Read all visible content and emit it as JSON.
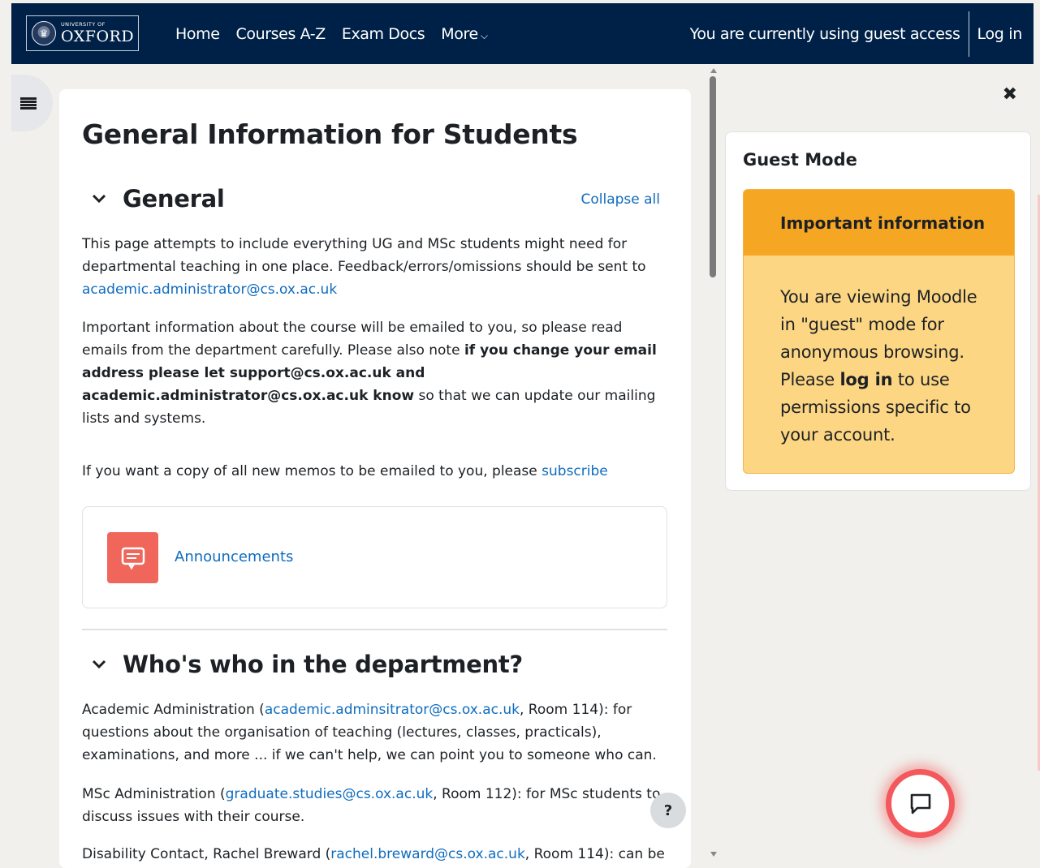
{
  "header": {
    "logo": {
      "line1": "UNIVERSITY OF",
      "line2": "OXFORD",
      "icon": "crest-icon"
    },
    "nav": [
      {
        "label": "Home"
      },
      {
        "label": "Courses A-Z"
      },
      {
        "label": "Exam Docs"
      },
      {
        "label": "More",
        "icon": "chevron-down-icon"
      }
    ],
    "guest_text": "You are currently using guest access",
    "login_label": "Log in"
  },
  "course_index_toggle": {
    "icon": "list-icon"
  },
  "main": {
    "page_title": "General Information for Students",
    "collapse_all": "Collapse all",
    "sections": [
      {
        "title": "General",
        "paragraphs": {
          "p1_text": "This page attempts to include everything UG and MSc students might need for departmental teaching in one place. Feedback/errors/omissions should be sent to ",
          "p1_link": "academic.administrator@cs.ox.ac.uk",
          "p2_text1": "Important information about the course will be emailed to you, so please read emails from the department carefully. Please also note ",
          "p2_bold": "if you change your email address please let support@cs.ox.ac.uk and academic.administrator@cs.ox.ac.uk know",
          "p2_text2": " so that we can update our mailing lists and systems.",
          "p3_text": "If you want a copy of all new memos to be emailed to you, please ",
          "p3_link": "subscribe"
        },
        "activity": {
          "label": "Announcements",
          "icon": "forum-icon"
        }
      },
      {
        "title": "Who's who in the department?",
        "paragraphs": {
          "p1_text1": "Academic Administration (",
          "p1_link": "academic.adminsitrator@cs.ox.ac.uk",
          "p1_text2": ", Room 114): for questions about the organisation of teaching (lectures, classes, practicals), examinations, and more ... if we can't help, we can point you to someone who can.",
          "p2_text1": "MSc Administration (",
          "p2_link": "graduate.studies@cs.ox.ac.uk",
          "p2_text2": ", Room 112): for MSc students to discuss issues with their course.",
          "p3_text1": "Disability Contact, Rachel Breward (",
          "p3_link": "rachel.breward@cs.ox.ac.uk",
          "p3_text2": ", Room 114): can be"
        }
      }
    ]
  },
  "help_button": {
    "label": "?"
  },
  "right_drawer": {
    "close_icon": "close-icon",
    "block_title": "Guest Mode",
    "alert_title": "Important information",
    "alert_text1": "You are viewing Moodle in \"guest\" mode for anonymous browsing. Please ",
    "alert_bold": "log in",
    "alert_text2": " to use permissions specific to your account."
  },
  "chat_button": {
    "icon": "chat-bubble-icon"
  },
  "colors": {
    "header": "#002147",
    "link": "#0f6cbf",
    "alert_head": "#f5a623",
    "alert_body": "#fdd683",
    "announce": "#f0665a",
    "chat_ring": "#f2585c"
  }
}
